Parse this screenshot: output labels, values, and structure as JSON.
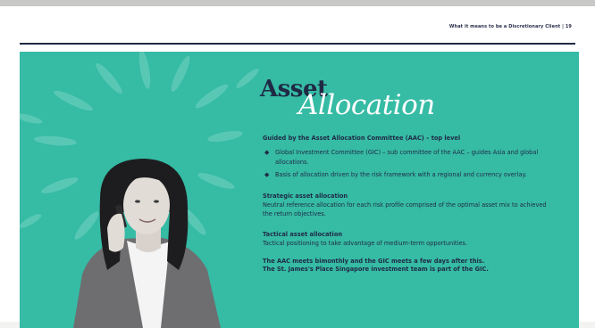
{
  "header": {
    "running_title": "What it means to be a Discretionary Client  |  19"
  },
  "title": {
    "line1": "Asset",
    "line2": "Allocation"
  },
  "content": {
    "governance_heading": "Guided by the Asset Allocation Committee (AAC) – top level",
    "bullets": [
      "Global Investment Committee (GIC) – sub committee of the AAC – guides Asia and global allocations.",
      "Basis of allocation driven by the risk framework with a regional and currency overlay."
    ],
    "strategic": {
      "heading": "Strategic asset allocation",
      "text": "Neutral reference allocation for each risk profile comprised of the optimal asset mix to achieved the return objectives."
    },
    "tactical": {
      "heading": "Tactical asset allocation",
      "text": "Tactical positioning to take advantage of medium-term opportunities."
    },
    "closing": {
      "line1": "The AAC meets bimonthly and the GIC meets a few days after this.",
      "line2": "The St. James's Place Singapore investment team is part of the GIC."
    }
  },
  "colors": {
    "panel": "#36bba5",
    "navy": "#1f2a44",
    "ray": "#5ecbb8"
  }
}
